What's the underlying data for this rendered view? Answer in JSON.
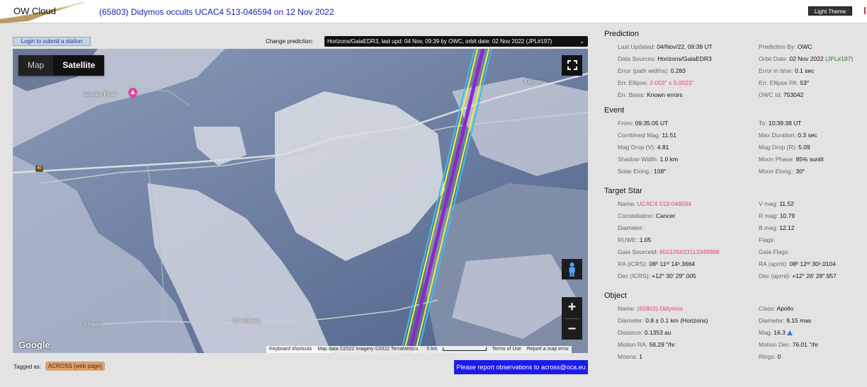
{
  "header": {
    "logo": "OW Cloud",
    "title": "(65803) Didymos occults UCAC4 513-046594 on 12 Nov 2022",
    "theme_button": "Light Theme"
  },
  "controls": {
    "login_button": "Login to submit a station",
    "change_label": "Change prediction:",
    "prediction_select": "Horizons/GaiaEDR3, last upd: 04 Nov, 09:39 by OWC, orbit date: 02 Nov 2022 (JPL#197)"
  },
  "map": {
    "type_map": "Map",
    "type_satellite": "Satellite",
    "labels": {
      "granite_peak": "Granite Peak",
      "kenner": "Kenner",
      "amboy": "Amboy",
      "chambless": "Chambless",
      "route": "40"
    },
    "zoom_in": "+",
    "zoom_out": "−",
    "google": "Google",
    "attribution": {
      "shortcuts": "Keyboard shortcuts",
      "data": "Map data ©2022 Imagery ©2022 TerraMetrics",
      "scale": "5 km",
      "terms": "Terms of Use",
      "report": "Report a map error"
    }
  },
  "footer": {
    "tagged_label": "Tagged as:",
    "tag": "ACROSS (web page)",
    "report_button": "Please report observations to across@oca.eu"
  },
  "prediction": {
    "title": "Prediction",
    "last_updated_label": "Last Updated:",
    "last_updated": "04/Nov/22, 09:39 UT",
    "prediction_by_label": "Prediction By:",
    "prediction_by": "OWC",
    "data_sources_label": "Data Sources:",
    "data_sources": "Horizons/GaiaEDR3",
    "orbit_date_label": "Orbit Date:",
    "orbit_date": "02 Nov 2022",
    "orbit_jpl": "(JPL#197)",
    "error_path_label": "Error (path widths):",
    "error_path": "0.283",
    "error_time_label": "Error in time:",
    "error_time": "0.1 sec",
    "err_ellipse_label": "Err. Ellipse:",
    "err_ellipse": "0.003\" x 0.0023\"",
    "err_ellipse_pa_label": "Err. Ellipse PA:",
    "err_ellipse_pa": "53°",
    "err_basis_label": "Err. Basis:",
    "err_basis": "Known errors",
    "owc_id_label": "OWC Id:",
    "owc_id": "753042"
  },
  "event": {
    "title": "Event",
    "from_label": "From:",
    "from": "09:35:05 UT",
    "to_label": "To:",
    "to": "10:39:38 UT",
    "combined_mag_label": "Combined Mag:",
    "combined_mag": "11.51",
    "max_duration_label": "Max Duration:",
    "max_duration": "0.3 sec",
    "mag_drop_v_label": "Mag Drop (V):",
    "mag_drop_v": "4.81",
    "mag_drop_r_label": "Mag Drop (R):",
    "mag_drop_r": "5.09",
    "shadow_width_label": "Shadow Width:",
    "shadow_width": "1.0 km",
    "moon_phase_label": "Moon Phase:",
    "moon_phase": "85% sunlit",
    "solar_elong_label": "Solar Elong.:",
    "solar_elong": "108°",
    "moon_elong_label": "Moon Elong.:",
    "moon_elong": "30°"
  },
  "target_star": {
    "title": "Target Star",
    "name_label": "Name:",
    "name": "UCAC4 513-046594",
    "vmag_label": "V mag:",
    "vmag": "11.52",
    "constellation_label": "Constellation:",
    "constellation": "Cancer",
    "rmag_label": "R mag:",
    "rmag": "10.79",
    "diameter_label": "Diameter:",
    "bmag_label": "B mag:",
    "bmag": "12.12",
    "ruwe_label": "RUWE:",
    "ruwe": "1.05",
    "flags_label": "Flags:",
    "gaia_id_label": "Gaia SourceId:",
    "gaia_id": "650105633113349888",
    "gaia_flags_label": "Gaia Flags:",
    "ra_icrs_label": "RA (ICRS):",
    "ra_icrs": "08ʰ 11ᵐ 14ˢ.3664",
    "ra_aprnt_label": "RA (aprnt):",
    "ra_aprnt": "08ʰ 12ᵐ 30ˢ.0104",
    "dec_icrs_label": "Dec (ICRS):",
    "dec_icrs": "+12° 30′ 29″.005",
    "dec_aprnt_label": "Dec (aprnt):",
    "dec_aprnt": "+12° 26′ 28″.957"
  },
  "object": {
    "title": "Object",
    "name_label": "Name:",
    "name": "(65803) Didymos",
    "class_label": "Class:",
    "class": "Apollo",
    "diameter_label": "Diameter:",
    "diameter": "0.8 ± 0.1 km",
    "diameter_src": "(Horizons)",
    "ang_diameter_label": "Diameter:",
    "ang_diameter": "8.15 mas",
    "distance_label": "Distance:",
    "distance": "0.1353 au",
    "mag_label": "Mag:",
    "mag": "16.3",
    "motion_ra_label": "Motion RA:",
    "motion_ra": "58.29 \"/hr",
    "motion_dec_label": "Motion Dec:",
    "motion_dec": "76.01 \"/hr",
    "moons_label": "Moons:",
    "moons": "1",
    "rings_label": "Rings:",
    "rings": "0"
  }
}
